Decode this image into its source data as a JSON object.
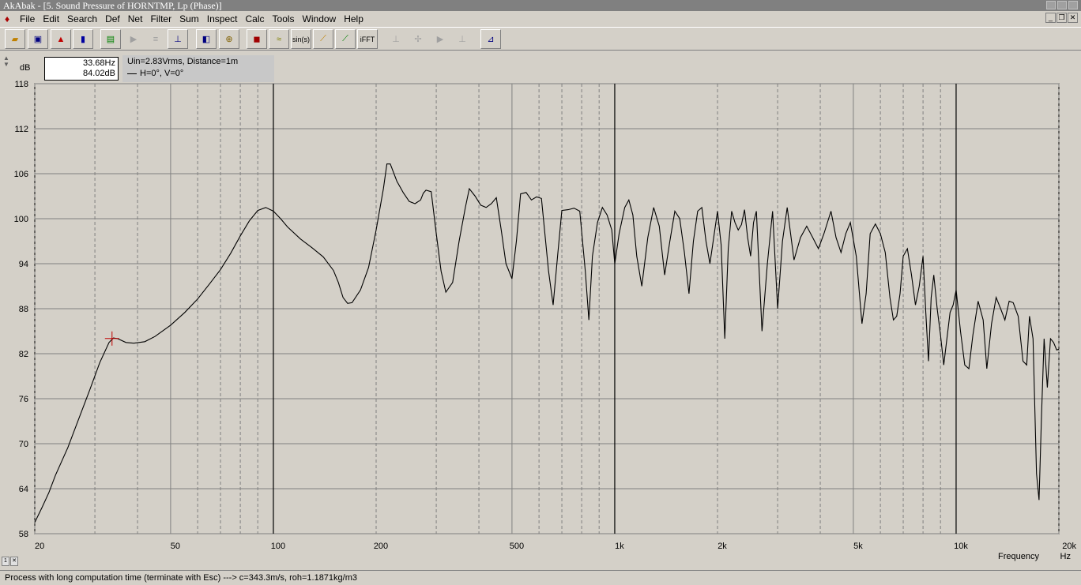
{
  "window": {
    "title": "AkAbak - [5. Sound Pressure of HORNTMP, Lp (Phase)]"
  },
  "menu": [
    "File",
    "Edit",
    "Search",
    "Def",
    "Net",
    "Filter",
    "Sum",
    "Inspect",
    "Calc",
    "Tools",
    "Window",
    "Help"
  ],
  "toolbar": {
    "sin_label": "sin(s)",
    "ifft_label": "iFFT"
  },
  "cursor": {
    "freq": "33.68Hz",
    "level": "84.02dB"
  },
  "legend": {
    "conditions": "Uin=2.83Vrms, Distance=1m",
    "series": "H=0°, V=0°"
  },
  "axis_unit": "dB",
  "statusbar": {
    "text": "Process with long computation time (terminate with Esc) ---> c=343.3m/s, roh=1.1871kg/m3"
  },
  "chart_data": {
    "type": "line",
    "xlabel": "Frequency",
    "xunit": "Hz",
    "ylabel": "dB",
    "xscale": "log",
    "xlim": [
      20,
      20000
    ],
    "ylim": [
      58,
      118
    ],
    "yticks": [
      58,
      64,
      70,
      76,
      82,
      88,
      94,
      100,
      106,
      112,
      118
    ],
    "xticks": [
      {
        "v": 20,
        "label": "20"
      },
      {
        "v": 50,
        "label": "50"
      },
      {
        "v": 100,
        "label": "100"
      },
      {
        "v": 200,
        "label": "200"
      },
      {
        "v": 500,
        "label": "500"
      },
      {
        "v": 1000,
        "label": "1k"
      },
      {
        "v": 2000,
        "label": "2k"
      },
      {
        "v": 5000,
        "label": "5k"
      },
      {
        "v": 10000,
        "label": "10k"
      },
      {
        "v": 20000,
        "label": "20k"
      }
    ],
    "grid": true,
    "cursor_point": [
      33.68,
      84.02
    ],
    "series": [
      {
        "points": [
          [
            20,
            59.5
          ],
          [
            21,
            61.5
          ],
          [
            22,
            63.5
          ],
          [
            23,
            65.8
          ],
          [
            25,
            69.5
          ],
          [
            27,
            73.5
          ],
          [
            29,
            77.2
          ],
          [
            31,
            80.8
          ],
          [
            33,
            83.5
          ],
          [
            34,
            84.1
          ],
          [
            35,
            84.0
          ],
          [
            37,
            83.5
          ],
          [
            39,
            83.4
          ],
          [
            42,
            83.6
          ],
          [
            45,
            84.3
          ],
          [
            50,
            85.8
          ],
          [
            55,
            87.5
          ],
          [
            60,
            89.3
          ],
          [
            65,
            91.3
          ],
          [
            70,
            93.2
          ],
          [
            75,
            95.4
          ],
          [
            80,
            97.7
          ],
          [
            85,
            99.7
          ],
          [
            90,
            101.1
          ],
          [
            95,
            101.5
          ],
          [
            100,
            101.0
          ],
          [
            105,
            100.0
          ],
          [
            110,
            98.9
          ],
          [
            120,
            97.3
          ],
          [
            130,
            96.1
          ],
          [
            140,
            94.9
          ],
          [
            150,
            93.1
          ],
          [
            155,
            91.5
          ],
          [
            160,
            89.5
          ],
          [
            165,
            88.7
          ],
          [
            170,
            88.8
          ],
          [
            180,
            90.5
          ],
          [
            190,
            93.5
          ],
          [
            200,
            98.5
          ],
          [
            210,
            104.0
          ],
          [
            215,
            107.3
          ],
          [
            220,
            107.3
          ],
          [
            230,
            105.0
          ],
          [
            240,
            103.5
          ],
          [
            250,
            102.3
          ],
          [
            260,
            102.0
          ],
          [
            270,
            102.5
          ],
          [
            275,
            103.4
          ],
          [
            280,
            103.8
          ],
          [
            290,
            103.6
          ],
          [
            300,
            98.0
          ],
          [
            310,
            93.0
          ],
          [
            320,
            90.2
          ],
          [
            335,
            91.5
          ],
          [
            350,
            97.0
          ],
          [
            365,
            101.5
          ],
          [
            375,
            104.0
          ],
          [
            390,
            103.0
          ],
          [
            405,
            101.8
          ],
          [
            420,
            101.5
          ],
          [
            435,
            102.0
          ],
          [
            450,
            102.8
          ],
          [
            465,
            98.5
          ],
          [
            480,
            94.0
          ],
          [
            500,
            92.0
          ],
          [
            515,
            97.0
          ],
          [
            530,
            103.3
          ],
          [
            550,
            103.5
          ],
          [
            570,
            102.5
          ],
          [
            590,
            102.9
          ],
          [
            610,
            102.7
          ],
          [
            640,
            93.0
          ],
          [
            660,
            88.5
          ],
          [
            680,
            95.0
          ],
          [
            700,
            101.1
          ],
          [
            730,
            101.2
          ],
          [
            760,
            101.4
          ],
          [
            790,
            101.0
          ],
          [
            820,
            93.0
          ],
          [
            840,
            86.5
          ],
          [
            860,
            95.0
          ],
          [
            890,
            99.5
          ],
          [
            920,
            101.5
          ],
          [
            950,
            100.5
          ],
          [
            980,
            98.5
          ],
          [
            1000,
            94.0
          ],
          [
            1030,
            98.0
          ],
          [
            1070,
            101.5
          ],
          [
            1100,
            102.5
          ],
          [
            1130,
            100.5
          ],
          [
            1160,
            95.0
          ],
          [
            1200,
            91.0
          ],
          [
            1250,
            97.5
          ],
          [
            1300,
            101.5
          ],
          [
            1350,
            99.0
          ],
          [
            1400,
            92.5
          ],
          [
            1450,
            97.0
          ],
          [
            1500,
            101.0
          ],
          [
            1550,
            100.0
          ],
          [
            1600,
            95.5
          ],
          [
            1650,
            90.0
          ],
          [
            1700,
            97.0
          ],
          [
            1750,
            101.0
          ],
          [
            1800,
            101.5
          ],
          [
            1850,
            97.0
          ],
          [
            1900,
            94.0
          ],
          [
            1950,
            97.5
          ],
          [
            2000,
            101.0
          ],
          [
            2050,
            96.5
          ],
          [
            2100,
            84.0
          ],
          [
            2150,
            96.0
          ],
          [
            2200,
            101.0
          ],
          [
            2250,
            99.5
          ],
          [
            2300,
            98.5
          ],
          [
            2350,
            99.2
          ],
          [
            2400,
            101.2
          ],
          [
            2450,
            97.5
          ],
          [
            2500,
            95.0
          ],
          [
            2550,
            99.5
          ],
          [
            2600,
            101.0
          ],
          [
            2700,
            85.0
          ],
          [
            2800,
            94.0
          ],
          [
            2900,
            101.0
          ],
          [
            3000,
            88.0
          ],
          [
            3100,
            97.0
          ],
          [
            3200,
            101.5
          ],
          [
            3350,
            94.5
          ],
          [
            3500,
            97.5
          ],
          [
            3650,
            99.0
          ],
          [
            3800,
            97.5
          ],
          [
            3950,
            96.0
          ],
          [
            4100,
            98.0
          ],
          [
            4300,
            101.0
          ],
          [
            4450,
            97.5
          ],
          [
            4600,
            95.5
          ],
          [
            4750,
            98.0
          ],
          [
            4900,
            99.5
          ],
          [
            5100,
            95.0
          ],
          [
            5300,
            86.0
          ],
          [
            5450,
            90.0
          ],
          [
            5600,
            98.0
          ],
          [
            5800,
            99.3
          ],
          [
            6000,
            98.0
          ],
          [
            6200,
            95.5
          ],
          [
            6400,
            89.5
          ],
          [
            6550,
            86.5
          ],
          [
            6700,
            87.0
          ],
          [
            6850,
            90.0
          ],
          [
            7000,
            95.0
          ],
          [
            7200,
            96.0
          ],
          [
            7400,
            92.5
          ],
          [
            7600,
            88.5
          ],
          [
            7800,
            91.0
          ],
          [
            8000,
            95.0
          ],
          [
            8150,
            87.5
          ],
          [
            8300,
            81.0
          ],
          [
            8450,
            89.5
          ],
          [
            8600,
            92.5
          ],
          [
            8800,
            88.0
          ],
          [
            9000,
            84.5
          ],
          [
            9200,
            80.5
          ],
          [
            9400,
            84.0
          ],
          [
            9600,
            87.5
          ],
          [
            9800,
            88.5
          ],
          [
            10000,
            90.5
          ],
          [
            10300,
            85.0
          ],
          [
            10600,
            80.5
          ],
          [
            10900,
            80.0
          ],
          [
            11200,
            84.5
          ],
          [
            11600,
            89.0
          ],
          [
            12000,
            86.5
          ],
          [
            12300,
            80.0
          ],
          [
            12700,
            86.0
          ],
          [
            13100,
            89.5
          ],
          [
            13500,
            88.0
          ],
          [
            13900,
            86.5
          ],
          [
            14300,
            89.0
          ],
          [
            14700,
            88.8
          ],
          [
            15200,
            87.0
          ],
          [
            15700,
            81.0
          ],
          [
            16100,
            80.5
          ],
          [
            16400,
            87.0
          ],
          [
            16800,
            84.0
          ],
          [
            17200,
            66.0
          ],
          [
            17500,
            62.5
          ],
          [
            17800,
            74.0
          ],
          [
            18100,
            84.0
          ],
          [
            18500,
            77.5
          ],
          [
            18900,
            84.0
          ],
          [
            19300,
            83.5
          ],
          [
            19700,
            82.5
          ],
          [
            20000,
            82.6
          ]
        ]
      }
    ]
  }
}
